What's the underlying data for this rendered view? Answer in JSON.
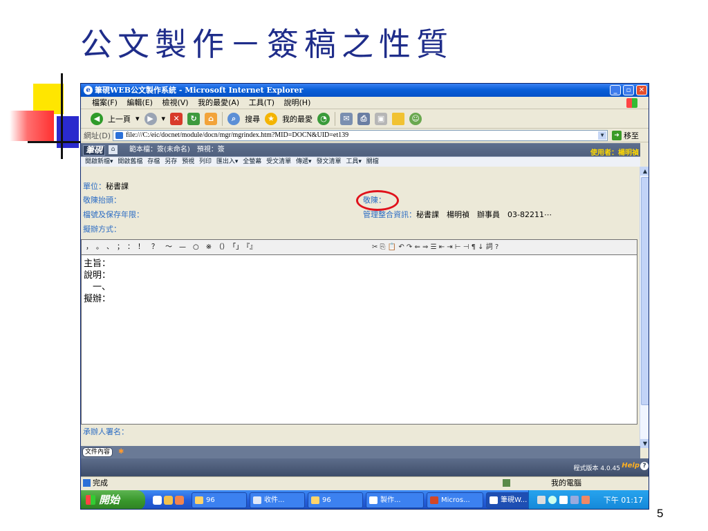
{
  "slide": {
    "title": "公文製作－簽稿之性質",
    "number": "5"
  },
  "window": {
    "title": "筆硯WEB公文製作系統 - Microsoft Internet Explorer"
  },
  "menu": [
    "檔案(F)",
    "編輯(E)",
    "檢視(V)",
    "我的最愛(A)",
    "工具(T)",
    "說明(H)"
  ],
  "toolbar": {
    "back": "上一頁",
    "search": "搜尋",
    "favorites": "我的最愛"
  },
  "address": {
    "label": "網址(D)",
    "url": "file:///C:/eic/docnet/module/docn/mgr/mgrindex.htm?MID=DOCN&UID=et139",
    "go": "移至"
  },
  "app": {
    "logo": "筆硯",
    "title": "範本檔：簽(未命名)　預視：簽",
    "user": "使用者：楊明禎",
    "toolbar_items": [
      "開啟新檔▾",
      "開啟舊檔",
      "存檔",
      "另存",
      "預視",
      "列印",
      "匯出入▾",
      "全螢幕",
      "受文清單",
      "傳遞▾",
      "發文清單",
      "工具▾",
      "關檔"
    ]
  },
  "form": {
    "unit_label": "單位：",
    "unit_value": "秘書課",
    "header_label": "敬陳抬頭：",
    "jingchen_label": "敬陳：",
    "archive_label": "檔號及保存年限：",
    "mgmt_label": "管理整合資訊：",
    "mgmt_value": "秘書課　楊明禎　辦事員　03-82211⋯",
    "method_label": "擬辦方式：",
    "signer_label": "承辦人署名："
  },
  "editor": {
    "punct": "，　。　、　；　：　！　？　～　—　○　※　（）　「」　『』",
    "tools": "✂ ⎘ 📋 ↶ ↷ ⇐ ⇒ ☰ ⇤ ⇥ ⊢ ⊣ ¶ ↓ 詞 ?",
    "lines": [
      "主旨：",
      "說明：",
      "　一、",
      "擬辦："
    ]
  },
  "footer": {
    "tab": "文件內容",
    "version": "程式版本 4.0.45",
    "help": "Help"
  },
  "status": {
    "text": "完成",
    "zone": "我的電腦"
  },
  "taskbar": {
    "start": "開始",
    "tasks": [
      "96",
      "收件...",
      "96",
      "製作...",
      "Micros...",
      "筆硯W..."
    ],
    "clock": "下午 01:17"
  }
}
